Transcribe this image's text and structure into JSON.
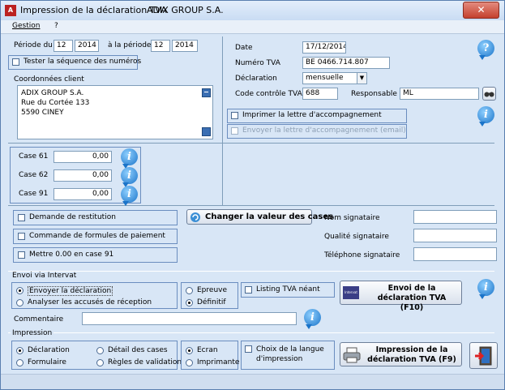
{
  "window": {
    "title": "Impression de la déclaration TVA",
    "company": "ADIX GROUP S.A.",
    "close_label": "✕"
  },
  "menu": {
    "gestion": "Gestion",
    "help": "?"
  },
  "periode": {
    "label_from": "Période du",
    "from_month": "12",
    "from_year": "2014",
    "label_to": "à la période",
    "to_month": "12",
    "to_year": "2014",
    "tester_label": "Tester la séquence des numéros"
  },
  "client": {
    "label": "Coordonnées client",
    "lines": [
      "ADIX GROUP S.A.",
      "Rue du Cortée 133",
      "5590  CINEY"
    ]
  },
  "right": {
    "date_label": "Date",
    "date_value": "17/12/2014",
    "tva_label": "Numéro TVA",
    "tva_value": "BE 0466.714.807",
    "decl_label": "Déclaration",
    "decl_value": "mensuelle",
    "code_label": "Code contrôle TVA",
    "code_value": "688",
    "resp_label": "Responsable",
    "resp_value": "ML",
    "letter_label": "Imprimer la lettre d'accompagnement",
    "email_label": "Envoyer la lettre d'accompagnement (email)"
  },
  "cases": [
    {
      "label": "Case 61",
      "value": "0,00"
    },
    {
      "label": "Case 62",
      "value": "0,00"
    },
    {
      "label": "Case 91",
      "value": "0,00"
    }
  ],
  "options": {
    "restitution": "Demande de restitution",
    "commande": "Commande  de formules de paiement",
    "mettre": "Mettre 0.00 en case 91",
    "changer_btn": "Changer la valeur des cases"
  },
  "signataire": {
    "nom": "Nom signataire",
    "qualite": "Qualité signataire",
    "tel": "Téléphone signataire"
  },
  "intervat": {
    "title": "Envoi via Intervat",
    "envoyer": "Envoyer la déclaration",
    "analyser": "Analyser les accusés de réception",
    "epreuve": "Epreuve",
    "definitif": "Définitif",
    "listing": "Listing TVA néant",
    "send_btn_line1": "Envoi de la déclaration TVA",
    "send_btn_line2": "(F10)",
    "send_icon_text": "Intervat",
    "commentaire": "Commentaire"
  },
  "impression": {
    "title": "Impression",
    "declaration": "Déclaration",
    "formulaire": "Formulaire",
    "detail": "Détail des cases",
    "regles": "Règles de validation",
    "ecran": "Ecran",
    "imprimante": "Imprimante",
    "langue_line1": "Choix de la langue",
    "langue_line2": "d'impression",
    "print_btn_line1": "Impression de la",
    "print_btn_line2": "déclaration TVA (F9)"
  },
  "icons": {
    "info": "info-icon",
    "help": "help-icon",
    "printer": "printer-icon",
    "exit": "exit-door-icon",
    "binoculars": "binoculars-icon"
  }
}
